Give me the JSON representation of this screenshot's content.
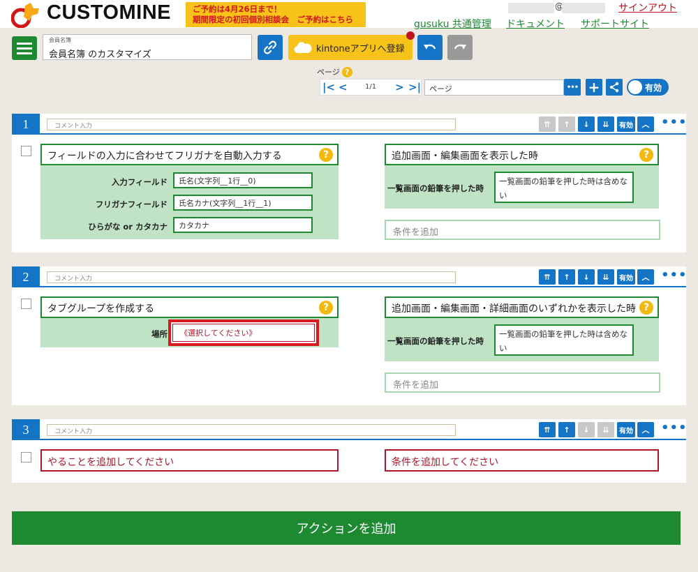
{
  "header": {
    "logo_text": "CUSTOMINE",
    "promo_line1": "ご予約は4月26日まで！",
    "promo_line2": "期間限定の初回個別相談会　ご予約はこちら",
    "at_sign": "@",
    "signout": "サインアウト",
    "links": [
      "gusuku 共通管理",
      "ドキュメント",
      "サポートサイト"
    ]
  },
  "toolbar": {
    "app_caption": "会員名簿",
    "app_name": "会員名簿 のカスタマイズ",
    "kintone_label": "kintoneアプリへ登録",
    "icons": [
      "menu-icon",
      "link-icon",
      "cloud-icon",
      "undo-icon",
      "redo-icon"
    ]
  },
  "page_nav": {
    "label": "ページ",
    "help": "?",
    "first": "|<",
    "prev": "<",
    "page_num": "1/1",
    "next": ">",
    "last": ">|",
    "page_name": "ページ",
    "more": "•••",
    "add": "+",
    "toggle_label": "有効"
  },
  "block_controls": {
    "enabled_label": "有効",
    "more": "•••"
  },
  "blocks": [
    {
      "number": "1",
      "comment_placeholder": "コメント入力",
      "action_title": "フィールドの入力に合わせてフリガナを自動入力する",
      "fields": [
        {
          "label": "入力フィールド",
          "value": "氏名(文字列__1行__0)"
        },
        {
          "label": "フリガナフィールド",
          "value": "氏名カナ(文字列__1行__1)"
        },
        {
          "label": "ひらがな or カタカナ",
          "value": "カタカナ"
        }
      ],
      "condition_title": "追加画面・編集画面を表示した時",
      "condition_label": "一覧画面の鉛筆を押した時",
      "condition_value": "一覧画面の鉛筆を押した時は含めない",
      "add_condition": "条件を追加"
    },
    {
      "number": "2",
      "comment_placeholder": "コメント入力",
      "action_title": "タブグループを作成する",
      "fields": [
        {
          "label": "場所",
          "value": "《選択してください》"
        }
      ],
      "condition_title": "追加画面・編集画面・詳細画面のいずれかを表示した時",
      "condition_label": "一覧画面の鉛筆を押した時",
      "condition_value": "一覧画面の鉛筆を押した時は含めない",
      "add_condition": "条件を追加"
    },
    {
      "number": "3",
      "comment_placeholder": "コメント入力",
      "add_action_prompt": "やることを追加してください",
      "add_condition_prompt": "条件を追加してください"
    }
  ],
  "add_action": "アクションを追加",
  "colors": {
    "brand_green": "#1d8a32",
    "brand_blue": "#1474c5",
    "promo_yellow": "#f8c318",
    "alert_red": "#d71920"
  }
}
